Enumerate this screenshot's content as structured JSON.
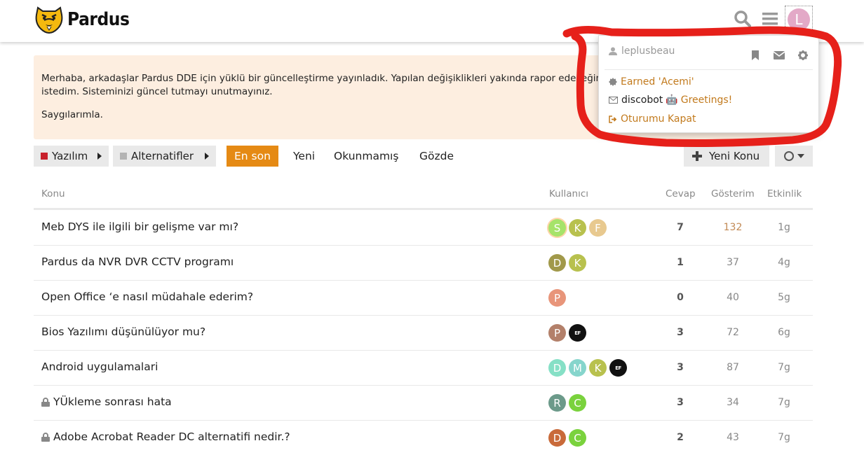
{
  "header": {
    "logo_text": "Pardus",
    "icons": [
      "tiger-logo-icon",
      "search-icon",
      "hamburger-icon"
    ],
    "avatar_letter": "L",
    "avatar_color": "#e3a9c7"
  },
  "banner": {
    "line1": "Merhaba, arkadaşlar Pardus DDE için yüklü bir güncelleştirme yayınladık. Yapılan değişiklikleri yakında rapor edeceğim",
    "line2": "istedim. Sisteminizi güncel tutmayı unutmayınız.",
    "line3": "Saygılarımla."
  },
  "nav": {
    "category": "Yazılım",
    "category_color": "#c8202b",
    "subcategory": "Alternatifler",
    "subcategory_color": "#b3b3b3",
    "tabs": [
      "En son",
      "Yeni",
      "Okunmamış",
      "Gözde"
    ],
    "active_tab": "En son",
    "new_topic": "Yeni Konu"
  },
  "table": {
    "headers": {
      "topic": "Konu",
      "users": "Kullanıcı",
      "replies": "Cevap",
      "views": "Gösterim",
      "activity": "Etkinlik"
    },
    "rows": [
      {
        "title": "Meb DYS ile ilgili bir gelişme var mı?",
        "locked": false,
        "users": [
          {
            "l": "S",
            "c": "#a6e36a"
          },
          {
            "l": "K",
            "c": "#b8c14e"
          },
          {
            "l": "F",
            "c": "#e8c98f"
          }
        ],
        "replies": "7",
        "views": "132",
        "hot": true,
        "activity": "1g"
      },
      {
        "title": "Pardus da NVR DVR CCTV programı",
        "locked": false,
        "users": [
          {
            "l": "D",
            "c": "#a1994a"
          },
          {
            "l": "K",
            "c": "#b8c14e"
          }
        ],
        "replies": "1",
        "views": "37",
        "hot": false,
        "activity": "4g"
      },
      {
        "title": "Open Office ‘e nasıl müdahale ederim?",
        "locked": false,
        "users": [
          {
            "l": "P",
            "c": "#e8957a"
          }
        ],
        "replies": "0",
        "views": "40",
        "hot": false,
        "activity": "5g"
      },
      {
        "title": "Bios Yazılımı düşünülüyor mu?",
        "locked": false,
        "users": [
          {
            "l": "P",
            "c": "#b3806a"
          },
          {
            "l": "EF",
            "c": "#111111"
          }
        ],
        "replies": "3",
        "views": "72",
        "hot": false,
        "activity": "6g"
      },
      {
        "title": "Android uygulamalari",
        "locked": false,
        "users": [
          {
            "l": "D",
            "c": "#86e0c6"
          },
          {
            "l": "M",
            "c": "#86d5cc"
          },
          {
            "l": "K",
            "c": "#b8c14e"
          },
          {
            "l": "EF",
            "c": "#111111"
          }
        ],
        "replies": "3",
        "views": "87",
        "hot": false,
        "activity": "7g"
      },
      {
        "title": "YÜkleme sonrası hata",
        "locked": true,
        "users": [
          {
            "l": "R",
            "c": "#6c9a8a"
          },
          {
            "l": "C",
            "c": "#7ad23d"
          }
        ],
        "replies": "3",
        "views": "34",
        "hot": false,
        "activity": "7g"
      },
      {
        "title": "Adobe Acrobat Reader DC alternatifi nedir.?",
        "locked": true,
        "users": [
          {
            "l": "D",
            "c": "#c96a3a"
          },
          {
            "l": "C",
            "c": "#7ad23d"
          }
        ],
        "replies": "2",
        "views": "43",
        "hot": false,
        "activity": "7g"
      }
    ]
  },
  "user_menu": {
    "username": "leplusbeau",
    "items": [
      {
        "icon": "badge-icon",
        "pre": "",
        "text": "Earned 'Acemi'"
      },
      {
        "icon": "envelope-icon",
        "pre": "discobot",
        "emoji": "🤖",
        "text": "Greetings!"
      },
      {
        "icon": "logout-icon",
        "pre": "",
        "text": "Oturumu Kapat"
      }
    ]
  },
  "colors": {
    "accent": "#e58a14",
    "link": "#c27a1d",
    "annotation": "#e6201a"
  }
}
